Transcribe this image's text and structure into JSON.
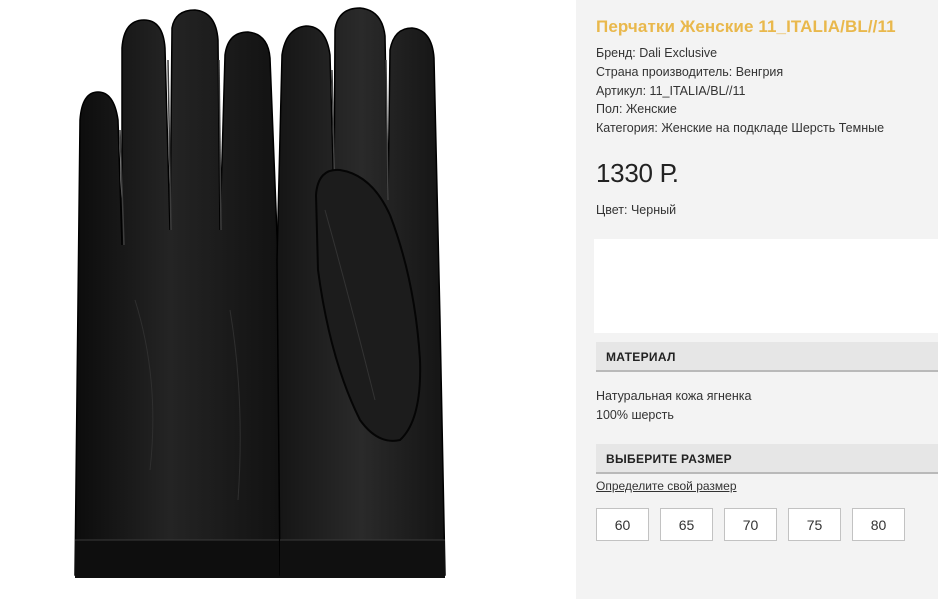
{
  "product": {
    "title": "Перчатки Женские 11_ITALIA/BL//11",
    "specs": [
      "Бренд: Dali Exclusive",
      "Страна производитель: Венгрия",
      "Артикул: 11_ITALIA/BL//11",
      "Пол: Женские",
      "Категория: Женские на подкладе Шерсть Темные"
    ],
    "price": "1330 Р.",
    "color": "Цвет: Черный"
  },
  "material": {
    "header": "МАТЕРИАЛ",
    "lines": [
      "Натуральная кожа ягненка",
      "100% шерсть"
    ]
  },
  "sizes": {
    "header": "ВЫБЕРИТЕ РАЗМЕР",
    "link": "Определите свой размер",
    "options": [
      "60",
      "65",
      "70",
      "75",
      "80"
    ]
  },
  "colors": {
    "title": "#e9b84c",
    "panel_bg": "#f3f3f3",
    "header_bg": "#e6e6e6"
  }
}
